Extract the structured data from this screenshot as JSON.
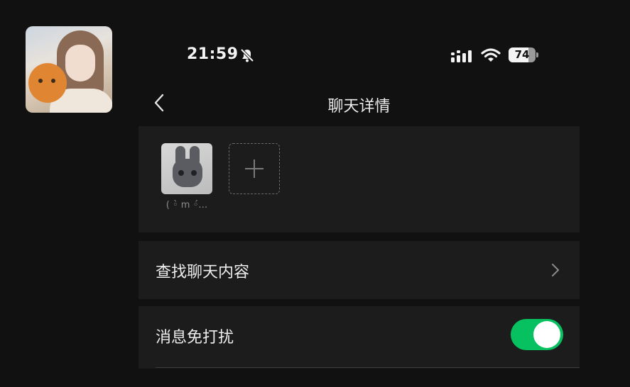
{
  "status_bar": {
    "time": "21:59",
    "battery_level": "74",
    "battery_fraction": 0.74,
    "icons": [
      "bell-slash-icon",
      "cellular-signal-icon",
      "wifi-icon",
      "battery-icon"
    ]
  },
  "nav": {
    "title": "聊天详情",
    "back_icon": "chevron-left-icon"
  },
  "members": {
    "items": [
      {
        "name": "( ◦̀ m ◦́…"
      }
    ],
    "add_icon": "plus-icon"
  },
  "rows": {
    "search_history": {
      "label": "查找聊天内容",
      "icon": "chevron-right-icon"
    },
    "mute": {
      "label": "消息免打扰",
      "enabled": true
    }
  },
  "colors": {
    "background": "#111111",
    "card": "#1c1c1c",
    "toggle_on": "#07c160",
    "text": "#ededed",
    "secondary_text": "#8c8c8c"
  }
}
